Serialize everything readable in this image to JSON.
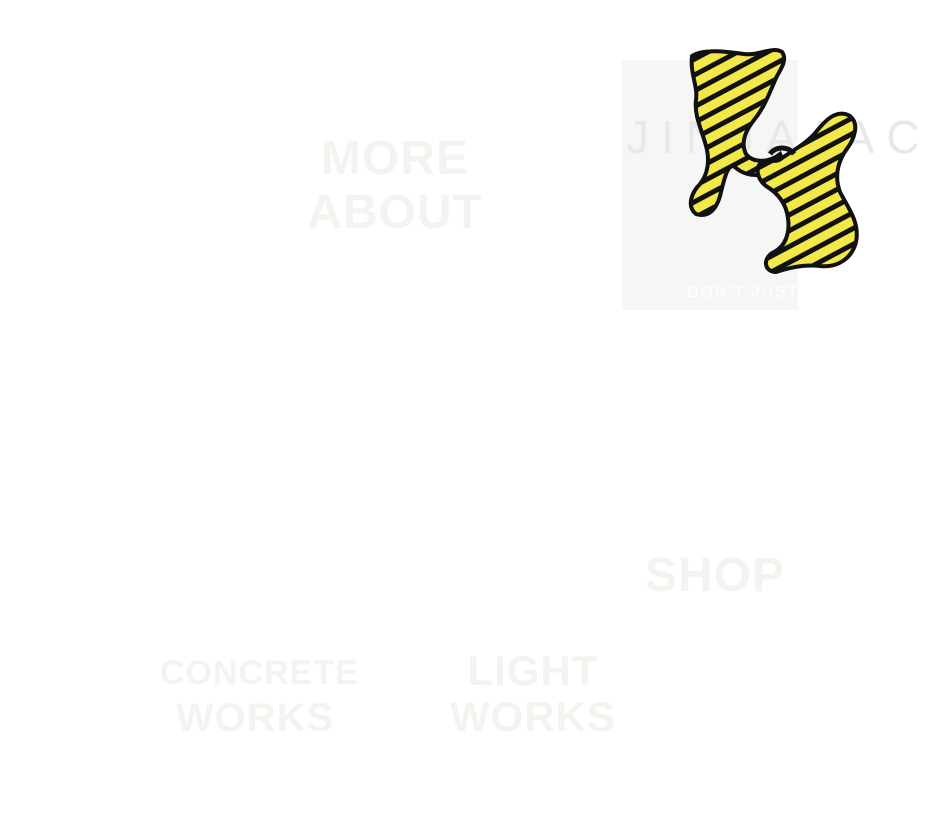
{
  "logo": {
    "wordmark": "JINJAJAC",
    "tagline": "DON'T JUST",
    "colors": {
      "yellow": "#f3e84a",
      "stripe": "#111111"
    }
  },
  "nav": {
    "more_about": [
      "MORE",
      "ABOUT"
    ],
    "shop": "SHOP",
    "concrete_works": [
      "CONCRETE",
      "WORKS"
    ],
    "light_works": [
      "LIGHT",
      "WORKS"
    ]
  }
}
